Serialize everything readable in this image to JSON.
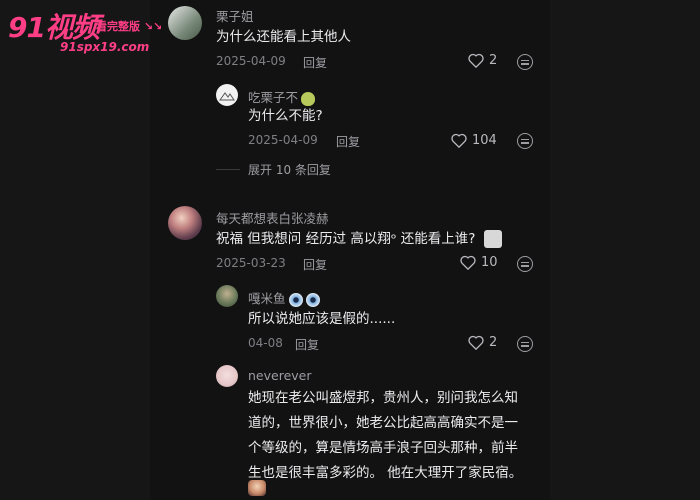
{
  "watermark": {
    "brand": "91视频",
    "tag": "看完整版 ↘↘",
    "url": "91spx19.com"
  },
  "comments": [
    {
      "username": "栗子姐",
      "lines": [
        "为什么还能看上其他人"
      ],
      "date": "2025-04-09",
      "reply": "回复",
      "likes": "2"
    },
    {
      "username": "吃栗子不",
      "lines": [
        "为什么不能?"
      ],
      "date": "2025-04-09",
      "reply": "回复",
      "likes": "104"
    },
    {
      "username": "每天都想表白张凌赫",
      "lines": [
        "祝福 但我想问 经历过 高以翔ᵒ 还能看上谁?"
      ],
      "date": "2025-03-23",
      "reply": "回复",
      "likes": "10"
    },
    {
      "username": "嘎米鱼",
      "lines": [
        "所以说她应该是假的......"
      ],
      "date": "04-08",
      "reply": "回复",
      "likes": "2"
    },
    {
      "username": "neverever",
      "lines": [
        "她现在老公叫盛煜邦，贵州人，别问我怎么知",
        "道的，世界很小，她老公比起高高确实不是一",
        "个等级的，算是情场高手浪子回头那种，前半",
        "生也是很丰富多彩的。 他在大理开了家民宿。"
      ]
    }
  ],
  "expand_replies": "展开 10 条回复",
  "colors": {
    "brand": "#ff3e86",
    "background": "#121213",
    "text": "#ececee",
    "muted": "#7f7f84"
  }
}
